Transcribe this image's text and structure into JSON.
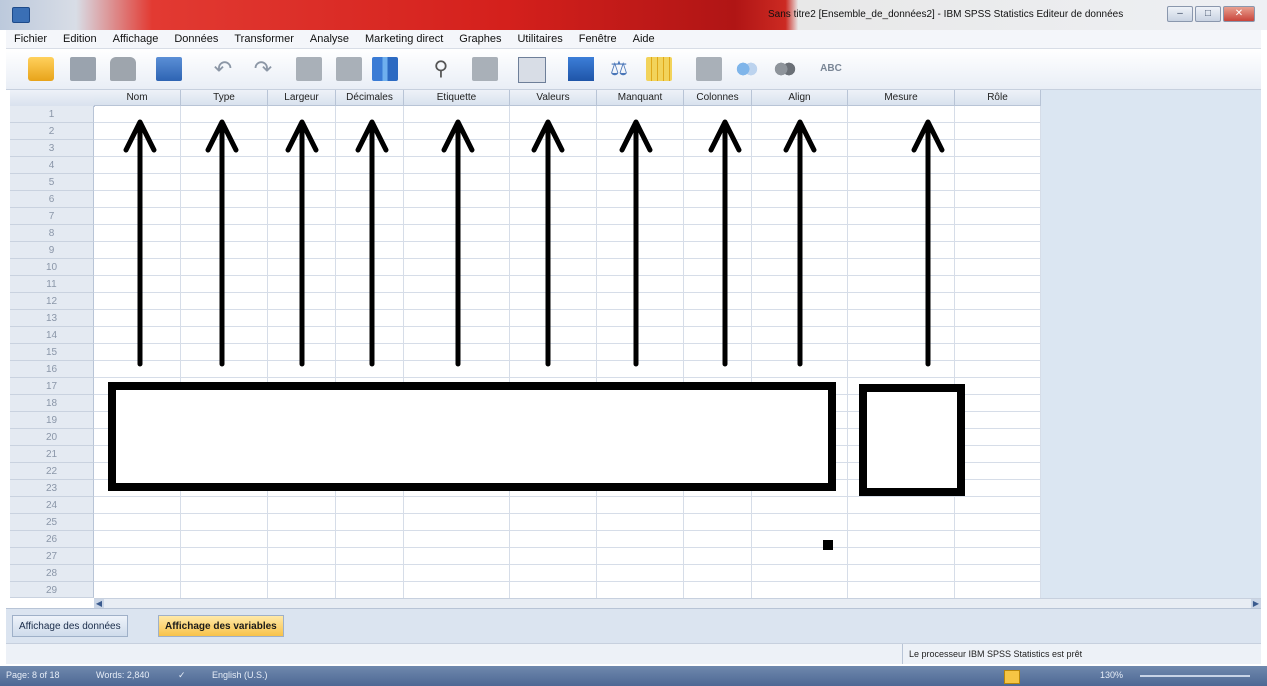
{
  "window": {
    "title": "Sans titre2 [Ensemble_de_données2] - IBM SPSS Statistics Editeur de données",
    "controls": [
      "–",
      "□",
      "✕"
    ]
  },
  "menu": [
    "Fichier",
    "Edition",
    "Affichage",
    "Données",
    "Transformer",
    "Analyse",
    "Marketing direct",
    "Graphes",
    "Utilitaires",
    "Fenêtre",
    "Aide"
  ],
  "toolbar_icons": [
    "open-folder-icon",
    "save-icon",
    "print-icon",
    "dialog-recall-icon",
    "undo-icon",
    "redo-icon",
    "goto-case-icon",
    "goto-variable-icon",
    "variables-icon",
    "find-icon",
    "insert-cases-icon",
    "insert-variable-icon",
    "split-file-icon",
    "weight-cases-icon",
    "select-cases-icon",
    "value-labels-icon",
    "use-sets-icon",
    "show-all-icon",
    "spell-check-icon"
  ],
  "columns": [
    "Nom",
    "Type",
    "Largeur",
    "Décimales",
    "Etiquette",
    "Valeurs",
    "Manquant",
    "Colonnes",
    "Align",
    "Mesure",
    "Rôle"
  ],
  "rows": [
    "1",
    "2",
    "3",
    "4",
    "5",
    "6",
    "7",
    "8",
    "9",
    "10",
    "11",
    "12",
    "13",
    "14",
    "15",
    "16",
    "17",
    "18",
    "19",
    "20",
    "21",
    "22",
    "23",
    "24",
    "25",
    "26",
    "27",
    "28",
    "29"
  ],
  "tabs": {
    "data_view": "Affichage des données",
    "variable_view": "Affichage des variables",
    "active": "variable_view"
  },
  "status": "Le processeur IBM SPSS Statistics  est prêt",
  "word_status": {
    "page": "Page: 8 of 18",
    "words": "Words: 2,840",
    "language": "English (U.S.)",
    "zoom": "130%"
  },
  "colors": {
    "titlebar_red": "#d4201c",
    "grid_header": "#e4eaf2",
    "active_tab": "#f8c24a",
    "annotation": "#000000"
  }
}
